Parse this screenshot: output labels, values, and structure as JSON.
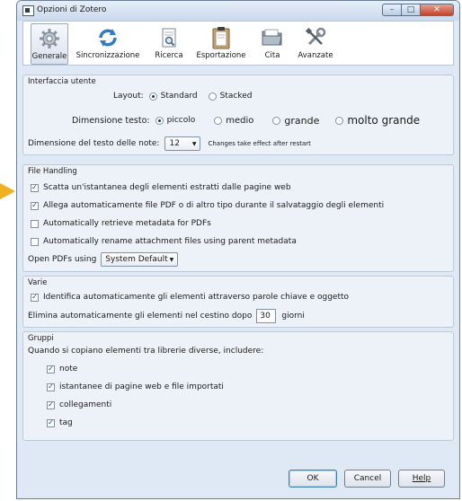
{
  "window": {
    "title": "Opzioni di Zotero",
    "controls": {
      "minimize": "–",
      "maximize": "□",
      "close": "✕"
    }
  },
  "toolbar": {
    "tabs": [
      {
        "label": "Generale",
        "icon": "gear-icon",
        "selected": true
      },
      {
        "label": "Sincronizzazione",
        "icon": "sync-icon",
        "selected": false
      },
      {
        "label": "Ricerca",
        "icon": "search-doc-icon",
        "selected": false
      },
      {
        "label": "Esportazione",
        "icon": "clipboard-icon",
        "selected": false
      },
      {
        "label": "Cita",
        "icon": "folder-icon",
        "selected": false
      },
      {
        "label": "Avanzate",
        "icon": "tools-icon",
        "selected": false
      }
    ]
  },
  "ui": {
    "legend": "Interfaccia utente",
    "layout_label": "Layout:",
    "layout_options": [
      "Standard",
      "Stacked"
    ],
    "layout_selected": "Standard",
    "font_size_label": "Dimensione testo:",
    "font_size_options": [
      "piccolo",
      "medio",
      "grande",
      "molto grande"
    ],
    "font_size_selected": "piccolo",
    "notes_font_label": "Dimensione del testo delle note:",
    "notes_font_value": "12",
    "notes_font_hint": "Changes take effect after restart"
  },
  "file_handling": {
    "legend": "File Handling",
    "options": [
      {
        "label": "Scatta un'istantanea degli elementi estratti dalle pagine web",
        "checked": true
      },
      {
        "label": "Allega automaticamente file PDF o di altro tipo durante il salvataggio degli elementi",
        "checked": true
      },
      {
        "label": "Automatically retrieve metadata for PDFs",
        "checked": false
      },
      {
        "label": "Automatically rename attachment files using parent metadata",
        "checked": false
      }
    ],
    "open_pdfs_label": "Open PDFs using",
    "open_pdfs_value": "System Default"
  },
  "misc": {
    "legend": "Varie",
    "auto_tag_label": "Identifica automaticamente gli elementi attraverso parole chiave e oggetto",
    "auto_tag_checked": true,
    "trash_label": "Elimina automaticamente gli elementi nel cestino dopo",
    "trash_days": "30",
    "trash_unit": "giorni"
  },
  "groups": {
    "legend": "Gruppi",
    "copy_label": "Quando si copiano elementi tra librerie diverse, includere:",
    "options": [
      {
        "label": "note",
        "checked": true
      },
      {
        "label": "istantanee di pagine web e file importati",
        "checked": true
      },
      {
        "label": "collegamenti",
        "checked": true
      },
      {
        "label": "tag",
        "checked": true
      }
    ]
  },
  "footer": {
    "ok": "OK",
    "cancel": "Cancel",
    "help": "Help"
  },
  "colors": {
    "window_bg": "#dfe9f5",
    "group_bg": "#edf2f8",
    "pointer": "#f0b020",
    "close_button": "#c3432c"
  }
}
